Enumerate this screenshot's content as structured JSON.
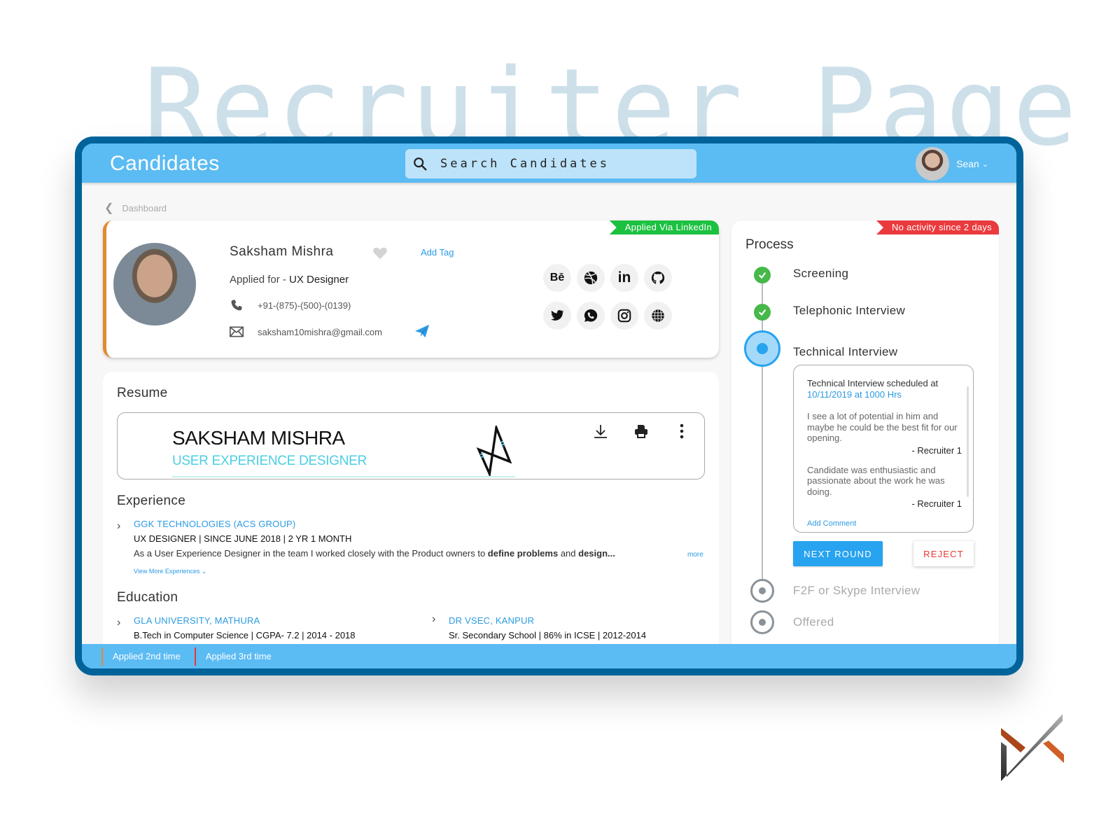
{
  "page_heading": "Recruiter Page",
  "header": {
    "title": "Candidates",
    "search_placeholder": "Search Candidates",
    "user_name": "Sean"
  },
  "breadcrumb": {
    "label": "Dashboard"
  },
  "candidate": {
    "name": "Saksham Mishra",
    "add_tag": "Add Tag",
    "applied_prefix": "Applied for - ",
    "applied_role": "UX Designer",
    "phone": "+91-(875)-(500)-(0139)",
    "email": "saksham10mishra@gmail.com",
    "source_badge": "Applied Via LinkedIn",
    "socials": [
      "behance",
      "dribbble",
      "linkedin",
      "github",
      "twitter",
      "whatsapp",
      "instagram",
      "website"
    ]
  },
  "resume": {
    "title": "Resume",
    "preview_name": "SAKSHAM MISHRA",
    "preview_role": "USER EXPERIENCE DESIGNER"
  },
  "experience": {
    "title": "Experience",
    "items": [
      {
        "company": "GGK TECHNOLOGIES (ACS GROUP)",
        "role_line": "UX DESIGNER | SINCE JUNE 2018 | 2 YR 1 MONTH",
        "desc_start": "As a User Experience Designer in the team I worked closely with the Product owners to ",
        "desc_bold1": "define problems",
        "desc_mid": " and ",
        "desc_bold2": "design...",
        "more": "more"
      }
    ],
    "view_more": "View More Experiences"
  },
  "education": {
    "title": "Education",
    "items": [
      {
        "school": "GLA UNIVERSITY, MATHURA",
        "detail": "B.Tech in Computer Science | CGPA- 7.2 | 2014 - 2018"
      },
      {
        "school": "DR VSEC, KANPUR",
        "detail": "Sr. Secondary School | 86% in ICSE |  2012-2014"
      }
    ]
  },
  "process": {
    "title": "Process",
    "activity_badge": "No activity since 2 days",
    "steps": [
      {
        "label": "Screening",
        "status": "done"
      },
      {
        "label": "Telephonic Interview",
        "status": "done"
      },
      {
        "label": "Technical Interview",
        "status": "active"
      },
      {
        "label": "F2F or Skype Interview",
        "status": "pending"
      },
      {
        "label": "Offered",
        "status": "pending"
      }
    ],
    "schedule_text": "Technical Interview scheduled at",
    "schedule_date": "10/11/2019 at 1000 Hrs",
    "comments": [
      {
        "text": "I see a lot of potential in him and maybe he could be the best fit for our opening.",
        "author": "- Recruiter 1"
      },
      {
        "text": "Candidate was enthusiastic and passionate about the work he was doing.",
        "author": "- Recruiter 1"
      }
    ],
    "add_comment": "Add Comment",
    "next_round": "NEXT ROUND",
    "reject": "REJECT"
  },
  "footer": {
    "tabs": [
      "Applied 2nd time",
      "Applied 3rd time"
    ]
  },
  "colors": {
    "header_bg": "#5bbbf3",
    "frame": "#00639a",
    "accent_blue": "#27a3ef",
    "success_green": "#47b84a",
    "linkedin_badge": "#1cc140",
    "alert_red": "#ea3a3d",
    "orange_marker": "#e3892f"
  }
}
